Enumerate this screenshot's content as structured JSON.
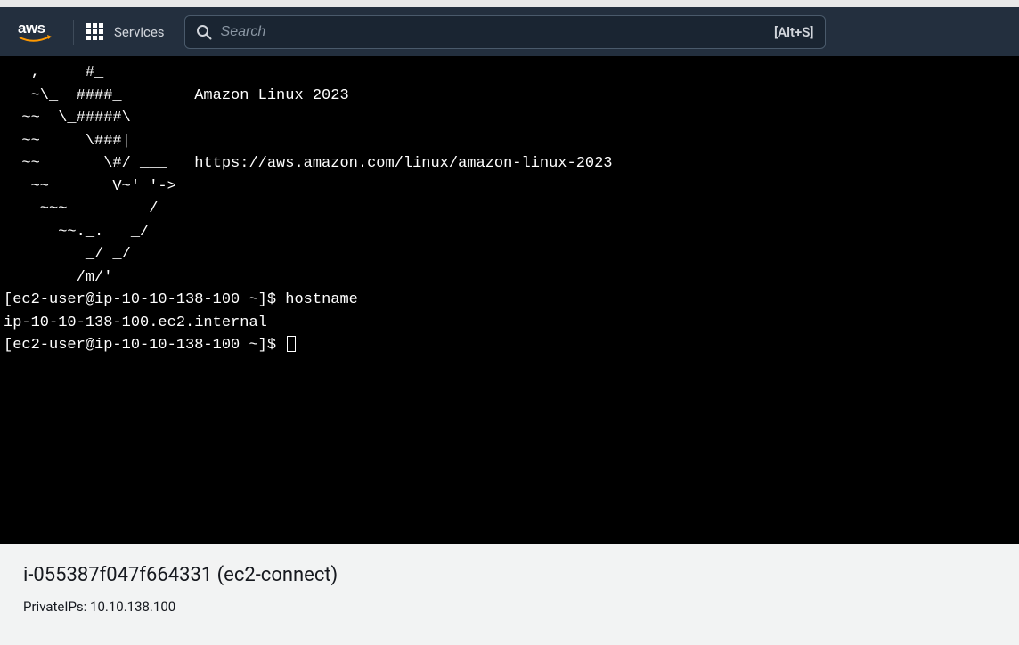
{
  "header": {
    "logo_text": "aws",
    "services_label": "Services",
    "search": {
      "placeholder": "Search",
      "shortcut": "[Alt+S]"
    }
  },
  "terminal": {
    "motd": "   ,     #_\n   ~\\_  ####_        Amazon Linux 2023\n  ~~  \\_#####\\\n  ~~     \\###|\n  ~~       \\#/ ___   https://aws.amazon.com/linux/amazon-linux-2023\n   ~~       V~' '->\n    ~~~         /\n      ~~._.   _/\n         _/ _/\n       _/m/'",
    "prompt1": "[ec2-user@ip-10-10-138-100 ~]$ ",
    "command1": "hostname",
    "output1": "ip-10-10-138-100.ec2.internal",
    "prompt2": "[ec2-user@ip-10-10-138-100 ~]$ "
  },
  "footer": {
    "instance_title": "i-055387f047f664331 (ec2-connect)",
    "private_ips_label": "PrivateIPs: ",
    "private_ips_value": "10.10.138.100"
  }
}
